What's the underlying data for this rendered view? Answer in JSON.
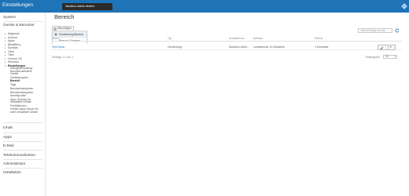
{
  "topbar": {
    "title": "Einstellungen",
    "toast": "Sandbox Admin ändern",
    "gear_icon": "gear-icon",
    "accent": "#1f73b7"
  },
  "sidebar": {
    "sections": [
      {
        "label": "System"
      },
      {
        "label": "Geräte & Benutzer"
      },
      {
        "label": "Inhalt"
      },
      {
        "label": "Apps"
      },
      {
        "label": "E-Mail"
      },
      {
        "label": "Telekommunikation"
      },
      {
        "label": "Administrator"
      },
      {
        "label": "Installation"
      }
    ],
    "tree": [
      {
        "label": "Allgemein"
      },
      {
        "label": "Android"
      },
      {
        "label": "Apple"
      },
      {
        "label": "BlackBerry"
      },
      {
        "label": "Symbian"
      },
      {
        "label": "OMA"
      },
      {
        "label": "Tizen"
      },
      {
        "label": "Chrome OS"
      },
      {
        "label": "Windows"
      },
      {
        "label": "Einstellungen"
      }
    ],
    "subitems": [
      {
        "label": "Abfolgeeinrichtung"
      },
      {
        "label": "Benutzerdefinierte"
      },
      {
        "label": "Geräte"
      },
      {
        "label": "Gerätegruppen"
      },
      {
        "label": "Bereich"
      },
      {
        "label": "Tags"
      },
      {
        "label": "Benutzerkategorien"
      },
      {
        "label": "Benutzerintegration"
      },
      {
        "label": "Arbeitsprofile"
      },
      {
        "label": "Apps (Schutz) für"
      },
      {
        "label": "verwaltete Geräte"
      },
      {
        "label": "Profilaktionen"
      },
      {
        "label": "Geräte-Apps-Schutz für"
      },
      {
        "label": "nicht verwaltete Geräte"
      }
    ]
  },
  "main": {
    "title": "Bereich",
    "add_button": "Hinzufügen",
    "dropdown": [
      {
        "label": "Geofencing-Bereich"
      },
      {
        "label": "Beacon-Gruppen"
      }
    ],
    "search_placeholder": "Listeneinträge suchen",
    "columns": [
      "Name",
      "Typ",
      "Verwaltet von",
      "Adresse",
      "Radius"
    ],
    "rows": [
      {
        "name": "TechTopia",
        "type": "Geofencing",
        "managed_by": "Sandbox Admi...",
        "address": "Landwehrstr. 61 München",
        "radius": "1 Kilometer"
      }
    ],
    "footer_info": "Einträge 1-1 von 1",
    "per_page_label": "Seitengröße",
    "per_page_value": "20"
  }
}
